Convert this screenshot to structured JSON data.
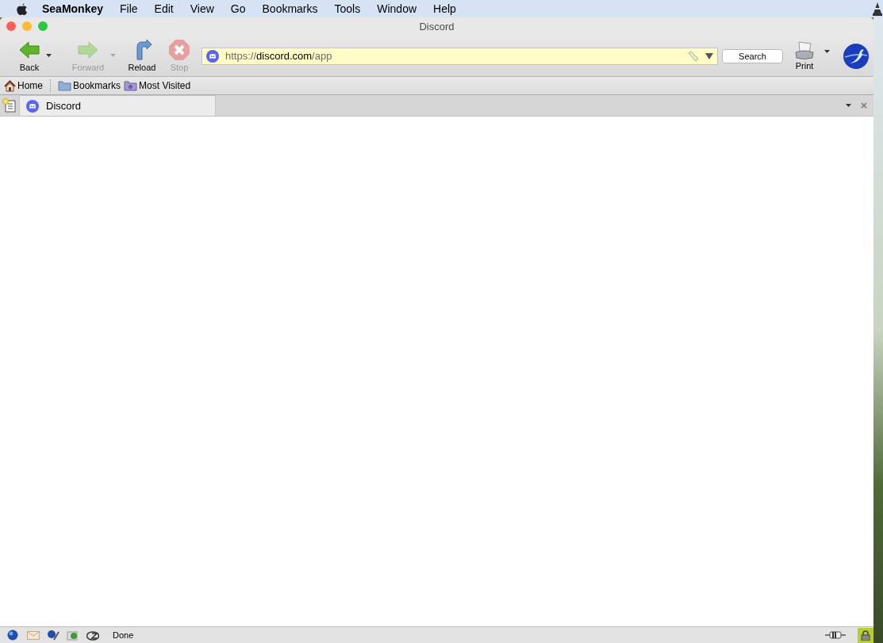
{
  "menu_bar": {
    "app": "SeaMonkey",
    "items": [
      "File",
      "Edit",
      "View",
      "Go",
      "Bookmarks",
      "Tools",
      "Window",
      "Help"
    ]
  },
  "window": {
    "title": "Discord"
  },
  "toolbar": {
    "buttons": [
      {
        "kind": "back",
        "label": "Back",
        "disabled": false,
        "dropdown": true
      },
      {
        "kind": "forward",
        "label": "Forward",
        "disabled": true,
        "dropdown": true
      },
      {
        "kind": "reload",
        "label": "Reload",
        "disabled": false,
        "dropdown": false
      },
      {
        "kind": "stop",
        "label": "Stop",
        "disabled": true,
        "dropdown": false
      }
    ],
    "url": {
      "scheme": "https://",
      "host": "discord.com",
      "path": "/app"
    },
    "search_button": "Search",
    "print_button": "Print"
  },
  "bookmarks_bar": [
    {
      "kind": "home",
      "label": "Home"
    },
    {
      "kind": "folder",
      "label": "Bookmarks"
    },
    {
      "kind": "smart-folder",
      "label": "Most Visited"
    }
  ],
  "tabs": [
    {
      "label": "Discord",
      "selected": true
    }
  ],
  "status_bar": {
    "text": "Done"
  }
}
